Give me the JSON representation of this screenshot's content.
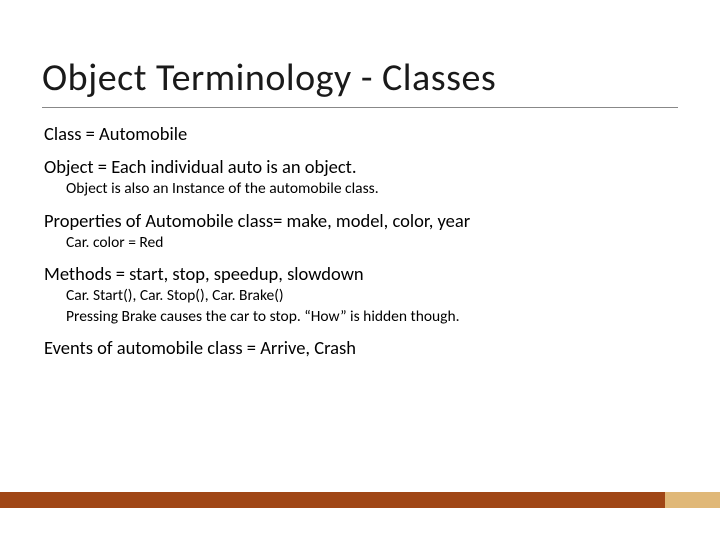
{
  "title": "Object Terminology - Classes",
  "lines": {
    "class": "Class = Automobile",
    "object": "Object = Each individual auto is an object.",
    "object_sub": "Object is also an Instance of the automobile class.",
    "properties": "Properties of Automobile class= make, model, color, year",
    "properties_sub": "Car. color = Red",
    "methods": "Methods = start, stop, speedup, slowdown",
    "methods_sub1": "Car. Start(), Car. Stop(), Car. Brake()",
    "methods_sub2": "Pressing Brake causes the car to stop.  “How” is hidden though.",
    "events": "Events of automobile class = Arrive, Crash"
  }
}
